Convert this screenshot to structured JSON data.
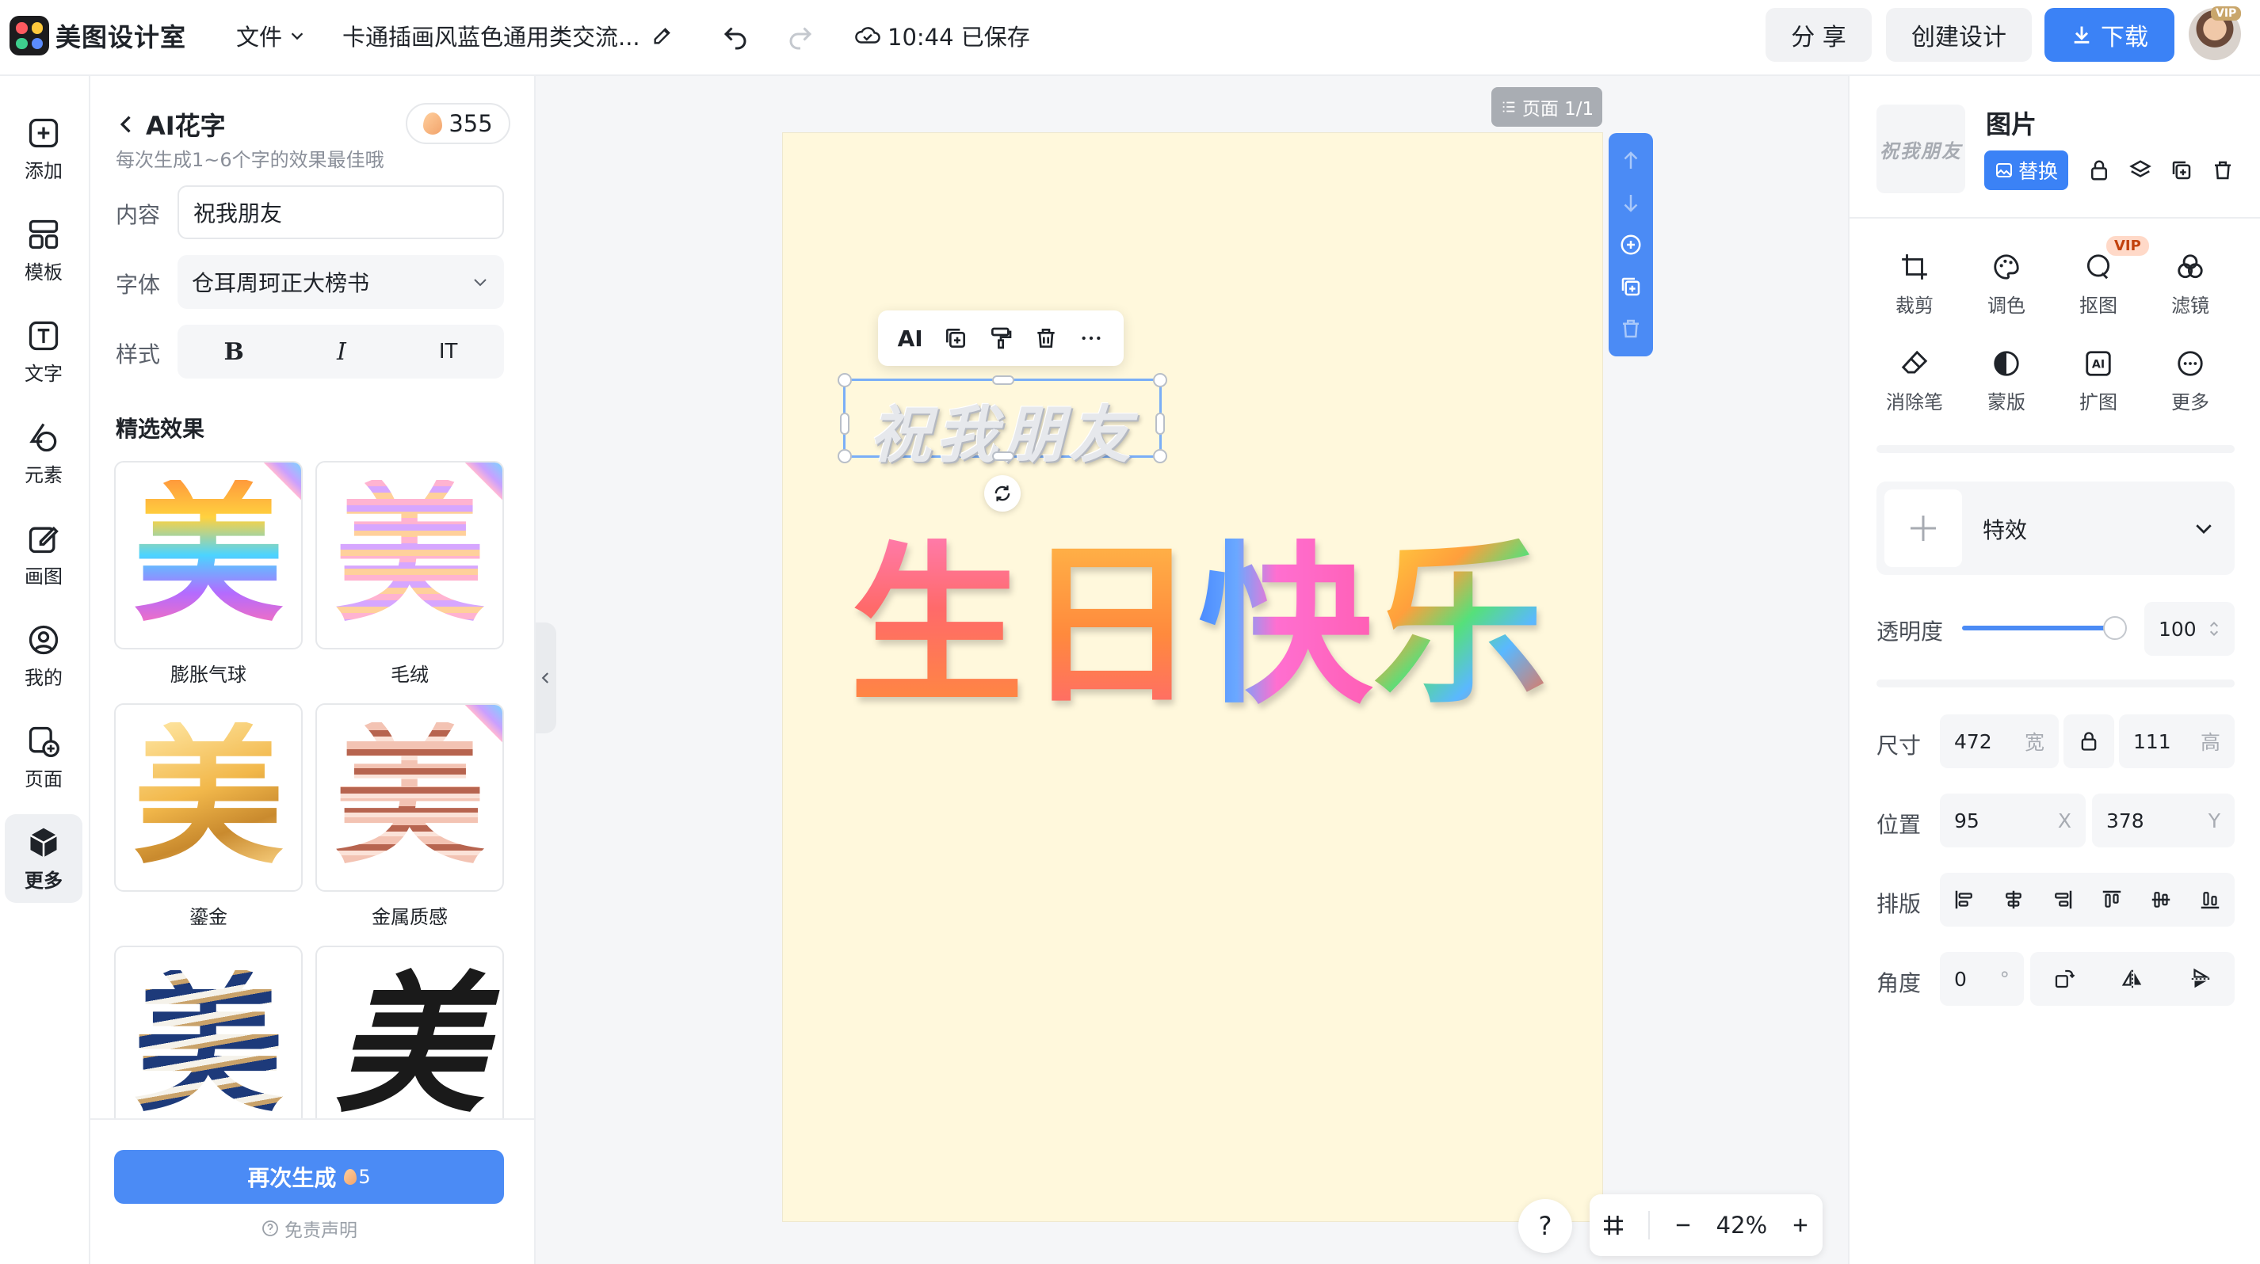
{
  "app": {
    "name": "美图设计室",
    "file_menu": "文件",
    "doc_title": "卡通插画风蓝色通用类交流...",
    "save_status": "10:44 已保存",
    "share": "分 享",
    "create_design": "创建设计",
    "download": "下载",
    "vip_badge": "VIP"
  },
  "rail": {
    "items": [
      {
        "label": "添加",
        "icon": "plus-square-icon"
      },
      {
        "label": "模板",
        "icon": "template-icon"
      },
      {
        "label": "文字",
        "icon": "text-icon"
      },
      {
        "label": "元素",
        "icon": "shapes-icon"
      },
      {
        "label": "画图",
        "icon": "draw-icon"
      },
      {
        "label": "我的",
        "icon": "user-icon"
      },
      {
        "label": "页面",
        "icon": "page-icon"
      },
      {
        "label": "更多",
        "icon": "cube-icon"
      }
    ],
    "active_index": 7
  },
  "panel": {
    "title": "AI花字",
    "credits": "355",
    "subtitle": "每次生成1~6个字的效果最佳哦",
    "content_label": "内容",
    "content_value": "祝我朋友",
    "font_label": "字体",
    "font_value": "仓耳周珂正大榜书",
    "style_label": "样式",
    "style_bold": "B",
    "style_italic": "I",
    "style_height": "IT",
    "section_title": "精选效果",
    "effects": [
      {
        "glyph": "美",
        "label": "膨胀气球",
        "badge": true
      },
      {
        "glyph": "美",
        "label": "毛绒",
        "badge": true
      },
      {
        "glyph": "美",
        "label": "鎏金",
        "badge": false
      },
      {
        "glyph": "美",
        "label": "金属质感",
        "badge": true
      },
      {
        "glyph": "美",
        "label": "",
        "badge": false
      },
      {
        "glyph": "美",
        "label": "",
        "badge": false
      }
    ],
    "regenerate": "再次生成",
    "regenerate_cost": "5",
    "disclaimer": "免责声明"
  },
  "canvas": {
    "page_badge": "页面 1/1",
    "context_ai": "AI",
    "wish_text": "祝我朋友",
    "birthday_chars": [
      "生",
      "日",
      "快",
      "乐"
    ],
    "zoom": "42%",
    "help": "?"
  },
  "right": {
    "thumb_text": "祝我朋友",
    "title": "图片",
    "replace": "替换",
    "tools_row1": [
      {
        "label": "裁剪",
        "icon": "crop-icon"
      },
      {
        "label": "调色",
        "icon": "palette-icon"
      },
      {
        "label": "抠图",
        "icon": "cutout-icon",
        "vip": true
      },
      {
        "label": "滤镜",
        "icon": "filter-icon"
      }
    ],
    "tools_row2": [
      {
        "label": "消除笔",
        "icon": "eraser-icon"
      },
      {
        "label": "蒙版",
        "icon": "mask-icon"
      },
      {
        "label": "扩图",
        "icon": "expand-icon"
      },
      {
        "label": "更多",
        "icon": "more-icon"
      }
    ],
    "vip_tag": "VIP",
    "effect_label": "特效",
    "opacity_label": "透明度",
    "opacity_value": "100",
    "opacity_fraction": 1.0,
    "size_label": "尺寸",
    "width_value": "472",
    "width_unit": "宽",
    "height_value": "111",
    "height_unit": "高",
    "position_label": "位置",
    "x_value": "95",
    "x_unit": "X",
    "y_value": "378",
    "y_unit": "Y",
    "arrange_label": "排版",
    "angle_label": "角度",
    "angle_value": "0",
    "angle_unit": "°"
  }
}
